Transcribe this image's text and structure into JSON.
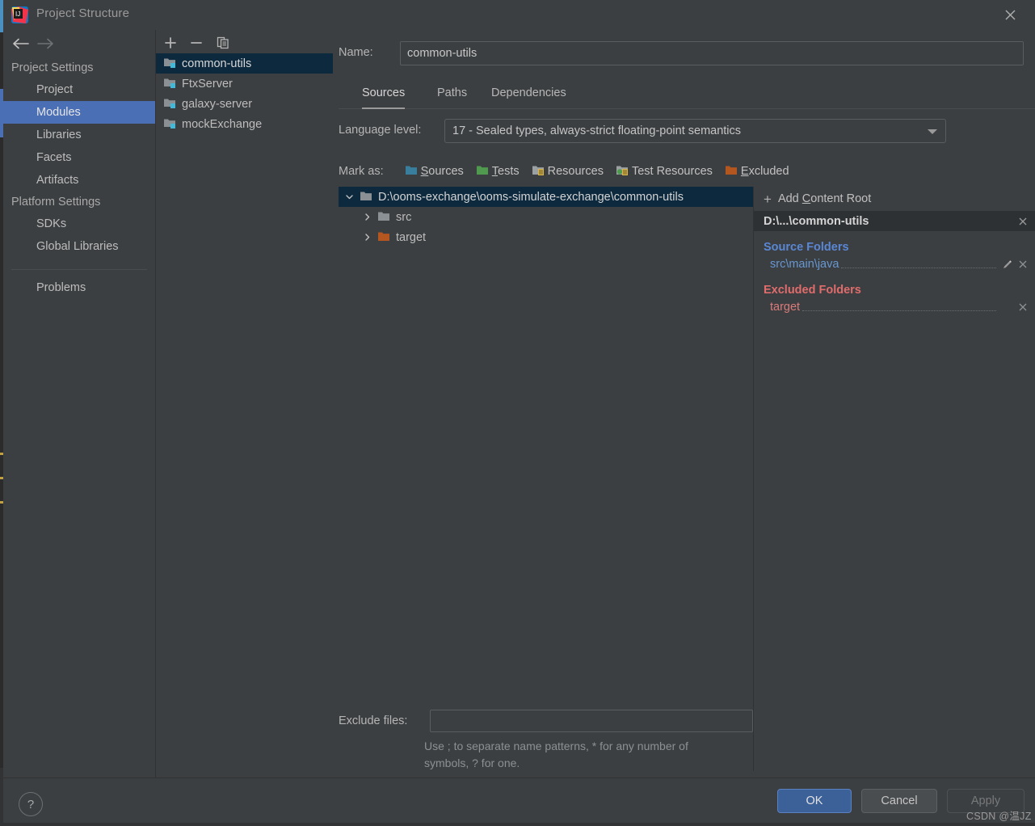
{
  "window": {
    "title": "Project Structure",
    "app_icon": "intellij-idea-icon",
    "close_label": "×"
  },
  "nav": {
    "back_icon": "arrow-left-icon",
    "forward_icon": "arrow-right-icon",
    "groups": [
      {
        "label": "Project Settings",
        "items": [
          {
            "label": "Project",
            "selected": false
          },
          {
            "label": "Modules",
            "selected": true
          },
          {
            "label": "Libraries",
            "selected": false
          },
          {
            "label": "Facets",
            "selected": false
          },
          {
            "label": "Artifacts",
            "selected": false
          }
        ]
      },
      {
        "label": "Platform Settings",
        "items": [
          {
            "label": "SDKs",
            "selected": false
          },
          {
            "label": "Global Libraries",
            "selected": false
          }
        ]
      }
    ],
    "problems_label": "Problems"
  },
  "modules": {
    "toolbar": {
      "add_label": "+",
      "remove_label": "−",
      "copy_icon": "copy-icon"
    },
    "items": [
      {
        "label": "common-utils",
        "selected": true
      },
      {
        "label": "FtxServer",
        "selected": false
      },
      {
        "label": "galaxy-server",
        "selected": false
      },
      {
        "label": "mockExchange",
        "selected": false
      }
    ]
  },
  "detail": {
    "name_label": "Name:",
    "name_value": "common-utils",
    "name_placeholder": "",
    "tabs": [
      {
        "label": "Sources",
        "active": true
      },
      {
        "label": "Paths",
        "active": false
      },
      {
        "label": "Dependencies",
        "active": false
      }
    ],
    "language_level_label": "Language level:",
    "language_level_value": "17 - Sealed types, always-strict floating-point semantics",
    "mark_as": {
      "label": "Mark as:",
      "options": [
        {
          "label": "Sources",
          "mnemonic": "S",
          "rest": "ources",
          "color": "#3a7e9e",
          "icon": "folder-sources-icon"
        },
        {
          "label": "Tests",
          "mnemonic": "T",
          "rest": "ests",
          "color": "#4f9a4f",
          "icon": "folder-tests-icon"
        },
        {
          "label": "Resources",
          "mnemonic": "R",
          "rest": "esources",
          "color": "#9ba0a3",
          "icon": "folder-resources-icon"
        },
        {
          "label": "Test Resources",
          "mnemonic": "",
          "rest": "Test Resources",
          "color": "#9ba0a3",
          "icon": "folder-test-resources-icon"
        },
        {
          "label": "Excluded",
          "mnemonic": "E",
          "rest": "xcluded",
          "color": "#b4561f",
          "icon": "folder-excluded-icon"
        }
      ]
    },
    "tree": [
      {
        "label": "D:\\ooms-exchange\\ooms-simulate-exchange\\common-utils",
        "expanded": true,
        "selected": true,
        "folder_color": "#8a9093",
        "indent": 0
      },
      {
        "label": "src",
        "expanded": false,
        "selected": false,
        "folder_color": "#8a9093",
        "indent": 1
      },
      {
        "label": "target",
        "expanded": false,
        "selected": false,
        "folder_color": "#b4561f",
        "indent": 1
      }
    ],
    "exclude_files_label": "Exclude files:",
    "exclude_files_value": "",
    "exclude_files_hint_line1": "Use ; to separate name patterns, * for any number of",
    "exclude_files_hint_line2": "symbols, ? for one."
  },
  "content_root": {
    "add_label_prefix": "Add ",
    "add_label_mnemonic": "C",
    "add_label_rest": "ontent Root",
    "add_plus": "+",
    "header_title": "D:\\...\\common-utils",
    "source_folders_label": "Source Folders",
    "source_folders": [
      {
        "name": "src\\main\\java",
        "has_edit": true,
        "has_remove": true
      }
    ],
    "excluded_folders_label": "Excluded Folders",
    "excluded_folders": [
      {
        "name": "target",
        "has_edit": false,
        "has_remove": true
      }
    ]
  },
  "footer": {
    "help_label": "?",
    "ok_label": "OK",
    "cancel_label": "Cancel",
    "apply_label": "Apply"
  },
  "watermark": "CSDN @温JZ",
  "colors": {
    "window_bg": "#3c3f41",
    "selection_blue": "#4a6fb5",
    "tree_selection": "#0d293e",
    "source_blue": "#6897d1",
    "excluded_red": "#d97b7b",
    "ok_button": "#3c6098"
  }
}
